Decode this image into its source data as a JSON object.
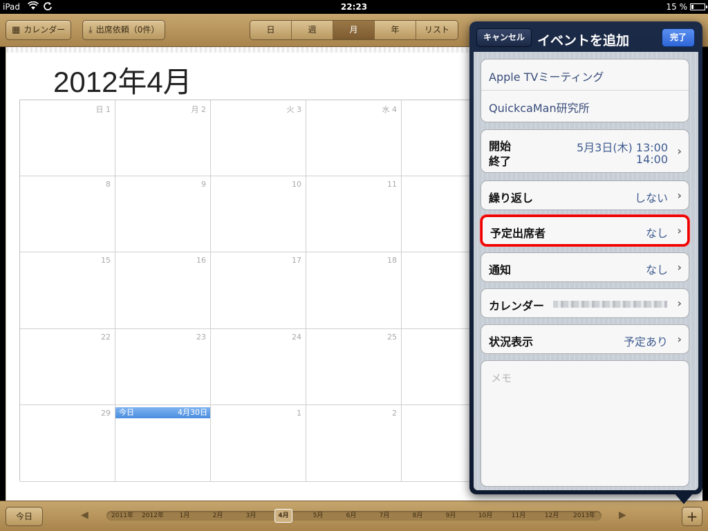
{
  "statusbar": {
    "device": "iPad",
    "time": "22:23",
    "battery": "15 %"
  },
  "toolbar": {
    "calendars_label": "カレンダー",
    "invitations_label": "出席依頼（0件）",
    "views": [
      "日",
      "週",
      "月",
      "年",
      "リスト"
    ],
    "selected_view": "月"
  },
  "calendar": {
    "month_title": "2012年4月",
    "weekday_headers": [
      "日",
      "月",
      "火",
      "水"
    ],
    "rows": [
      [
        "1",
        "2",
        "3",
        "4"
      ],
      [
        "8",
        "9",
        "10",
        "11"
      ],
      [
        "15",
        "16",
        "17",
        "18"
      ],
      [
        "22",
        "23",
        "24",
        "25"
      ],
      [
        "29",
        "",
        "1",
        "2"
      ]
    ],
    "today": {
      "label": "今日",
      "date": "4月30日"
    }
  },
  "bottombar": {
    "today_label": "今日",
    "timeline": [
      "2011年",
      "2012年",
      "1月",
      "2月",
      "3月",
      "4月",
      "5月",
      "6月",
      "7月",
      "8月",
      "9月",
      "10月",
      "11月",
      "12月",
      "2013年"
    ],
    "selected": "4月",
    "add_label": "+"
  },
  "popover": {
    "title": "イベントを追加",
    "cancel_label": "キャンセル",
    "done_label": "完了",
    "event_title": "Apple TVミーティング",
    "location": "QuickcaMan研究所",
    "start_label": "開始",
    "end_label": "終了",
    "start_value": "5月3日(木)  13:00",
    "end_value": "14:00",
    "repeat_label": "繰り返し",
    "repeat_value": "しない",
    "invitees_label": "予定出席者",
    "invitees_value": "なし",
    "alert_label": "通知",
    "alert_value": "なし",
    "calendar_label": "カレンダー",
    "availability_label": "状況表示",
    "availability_value": "予定あり",
    "notes_placeholder": "メモ"
  },
  "colors": {
    "highlight": "#e00000",
    "today": "#4b8ee0",
    "leather": "#b8985f",
    "popover": "#1b2a47"
  }
}
